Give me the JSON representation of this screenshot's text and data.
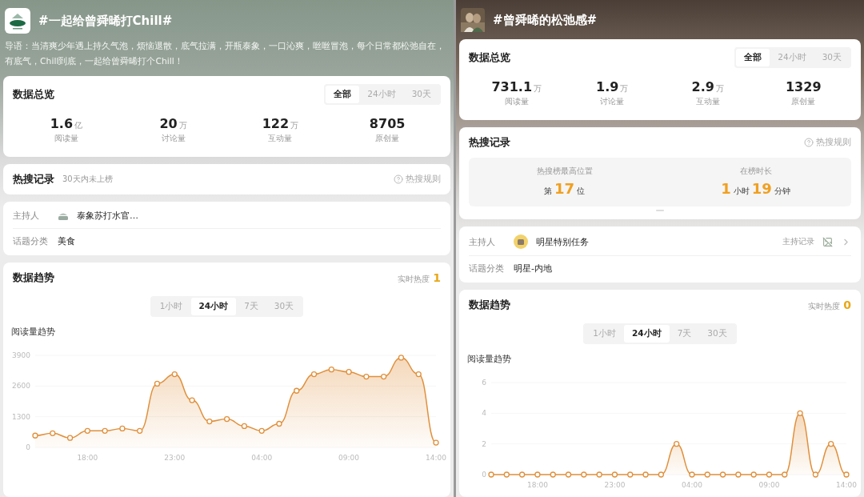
{
  "panels": [
    {
      "title": "#一起给曾舜晞打Chill#",
      "badge": {
        "kind": "logo"
      },
      "intro": "导语：当清爽少年遇上持久气泡，烦恼退散，底气拉满，开瓶泰象，一口沁爽，咝咝冒泡，每个日常都松弛自在，有底气，Chill到底，一起给曾舜晞打个Chill！",
      "overview": {
        "title": "数据总览",
        "ranges": [
          {
            "label": "全部",
            "selected": true
          },
          {
            "label": "24小时",
            "selected": false
          },
          {
            "label": "30天",
            "selected": false
          }
        ],
        "stats": [
          {
            "value": "1.6",
            "unit": "亿",
            "label": "阅读量"
          },
          {
            "value": "20",
            "unit": "万",
            "label": "讨论量"
          },
          {
            "value": "122",
            "unit": "万",
            "label": "互动量"
          },
          {
            "value": "8705",
            "label": "原创量"
          }
        ]
      },
      "hot_search": {
        "title": "热搜记录",
        "note": "30天内未上榜",
        "rules": "热搜规则"
      },
      "info": {
        "host_label": "主持人",
        "host_avatar": {
          "kind": "bottle"
        },
        "host": "泰象苏打水官…",
        "category_label": "话题分类",
        "category": "美食"
      },
      "trend": {
        "title": "数据趋势",
        "heat_label": "实时热度",
        "heat": "1",
        "ranges": [
          {
            "label": "1小时",
            "selected": false
          },
          {
            "label": "24小时",
            "selected": true
          },
          {
            "label": "7天",
            "selected": false
          },
          {
            "label": "30天",
            "selected": false
          }
        ],
        "chart_data": {
          "type": "area",
          "title": "阅读量趋势",
          "ylim": [
            0,
            3900
          ],
          "yticks": [
            0,
            1300,
            2600,
            3900
          ],
          "categories": [
            null,
            null,
            null,
            "18:00",
            null,
            null,
            null,
            null,
            "23:00",
            null,
            null,
            null,
            null,
            "04:00",
            null,
            null,
            null,
            null,
            "09:00",
            null,
            null,
            null,
            null,
            "14:00"
          ],
          "series": [
            {
              "color": "#e0903c",
              "values": [
                500,
                600,
                400,
                700,
                700,
                800,
                700,
                2700,
                3100,
                2000,
                1100,
                1200,
                900,
                700,
                1000,
                2400,
                3100,
                3300,
                3200,
                3000,
                3000,
                3800,
                3100,
                200
              ]
            }
          ]
        }
      }
    },
    {
      "title": "#曾舜晞的松弛感#",
      "overview": {
        "title": "数据总览",
        "ranges": [
          {
            "label": "全部",
            "selected": true
          },
          {
            "label": "24小时",
            "selected": false
          },
          {
            "label": "30天",
            "selected": false
          }
        ],
        "stats": [
          {
            "value": "731.1",
            "unit": "万",
            "label": "阅读量"
          },
          {
            "value": "1.9",
            "unit": "万",
            "label": "讨论量"
          },
          {
            "value": "2.9",
            "unit": "万",
            "label": "互动量"
          },
          {
            "value": "1329",
            "label": "原创量"
          }
        ]
      },
      "hot_search": {
        "title": "热搜记录",
        "rules": "热搜规则",
        "records": [
          {
            "label": "热搜榜最高位置",
            "parts": [
              {
                "kind": "unit",
                "text": "第"
              },
              {
                "kind": "number",
                "text": "17"
              },
              {
                "kind": "unit",
                "text": "位"
              }
            ]
          },
          {
            "label": "在榜时长",
            "parts": [
              {
                "kind": "number",
                "text": "1"
              },
              {
                "kind": "unit",
                "text": "小时"
              },
              {
                "kind": "number",
                "text": "19"
              },
              {
                "kind": "unit",
                "text": "分钟"
              }
            ]
          }
        ]
      },
      "info": {
        "host_label": "主持人",
        "host_avatar": {
          "kind": "avatar"
        },
        "host": "明星特别任务",
        "host_record": "主持记录",
        "category_label": "话题分类",
        "category": "明星-内地"
      },
      "trend": {
        "title": "数据趋势",
        "heat_label": "实时热度",
        "heat": "0",
        "ranges": [
          {
            "label": "1小时",
            "selected": false
          },
          {
            "label": "24小时",
            "selected": true
          },
          {
            "label": "7天",
            "selected": false
          },
          {
            "label": "30天",
            "selected": false
          }
        ],
        "chart_data": {
          "type": "area",
          "title": "阅读量趋势",
          "ylim": [
            0,
            6
          ],
          "yticks": [
            0,
            2,
            4,
            6
          ],
          "categories": [
            null,
            null,
            null,
            "18:00",
            null,
            null,
            null,
            null,
            "23:00",
            null,
            null,
            null,
            null,
            "04:00",
            null,
            null,
            null,
            null,
            "09:00",
            null,
            null,
            null,
            null,
            "14:00"
          ],
          "series": [
            {
              "color": "#e0903c",
              "values": [
                0,
                0,
                0,
                0,
                0,
                0,
                0,
                0,
                0,
                0,
                0,
                0,
                2,
                0,
                0,
                0,
                0,
                0,
                0,
                0,
                4,
                0,
                2,
                0
              ]
            }
          ]
        }
      }
    }
  ]
}
